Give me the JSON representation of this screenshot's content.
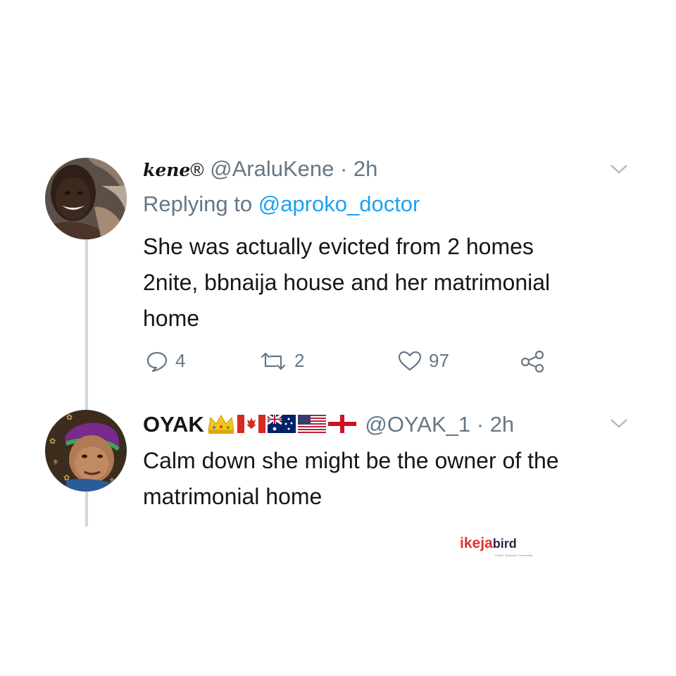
{
  "tweets": [
    {
      "display_name": "kene",
      "registered_mark": "®",
      "handle": "@AraluKene",
      "time": " · 2h",
      "replying_prefix": "Replying to ",
      "replying_to": "@aproko_doctor",
      "text_lines": [
        "She was actually evicted from 2 homes",
        "2nite, bbnaija house and her matrimonial",
        "home"
      ],
      "actions": {
        "replies": "4",
        "retweets": "2",
        "likes": "97"
      }
    },
    {
      "display_name": "OYAK",
      "name_emojis": [
        "crown",
        "canada-flag",
        "australia-flag",
        "usa-flag",
        "england-flag"
      ],
      "handle": "@OYAK_1",
      "time": " · 2h",
      "text_lines": [
        "Calm down she might be the owner of the",
        "matrimonial home"
      ]
    }
  ],
  "icons": [
    "chevron-down-icon",
    "reply-icon",
    "retweet-icon",
    "like-icon",
    "share-icon"
  ],
  "colors": {
    "link": "#1da1f2",
    "muted": "#657786",
    "text": "#14171a",
    "thread_line": "#ccd6dd"
  },
  "watermark": {
    "red_part": "ikeja",
    "dark_part": "bird",
    "tagline": "People. Business. Community"
  }
}
